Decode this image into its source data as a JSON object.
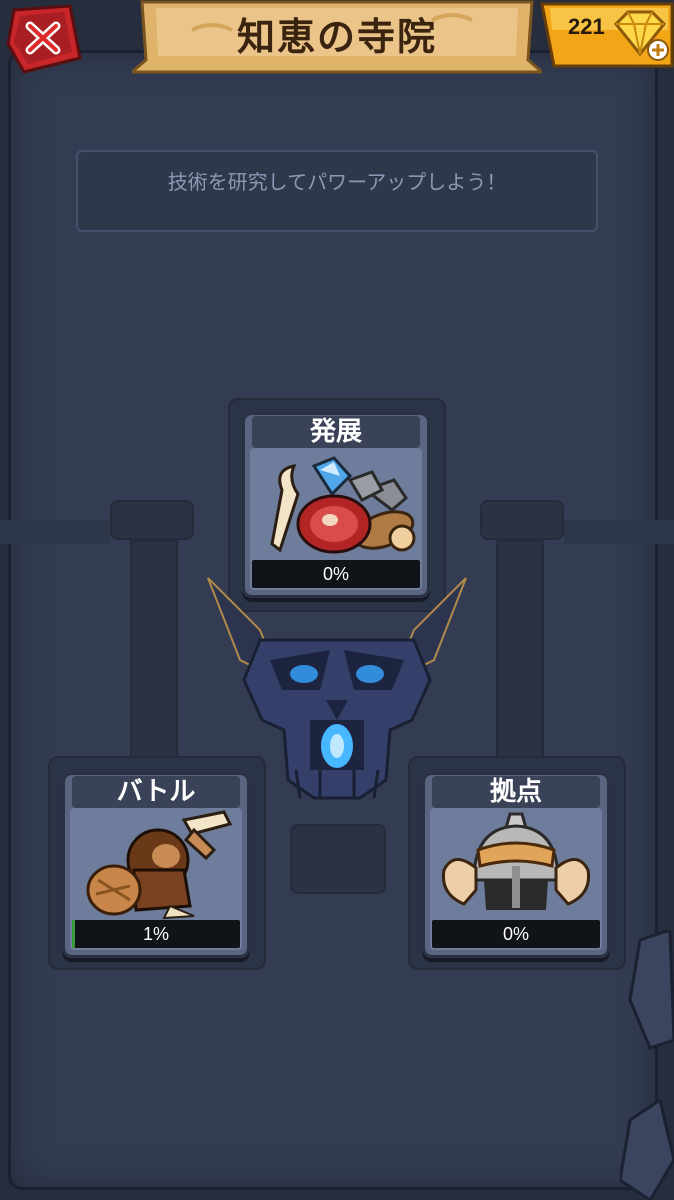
{
  "header": {
    "title": "知恵の寺院",
    "gem_count": "221"
  },
  "subtitle": "技術を研究してパワーアップしよう！",
  "cards": {
    "development": {
      "title": "発展",
      "percent": "0%",
      "progress": 0
    },
    "battle": {
      "title": "バトル",
      "percent": "1%",
      "progress": 0.01
    },
    "base": {
      "title": "拠点",
      "percent": "0%",
      "progress": 0
    }
  },
  "colors": {
    "banner": "#e0b36a",
    "gem_gold": "#f4b51c",
    "close_red": "#c8262a",
    "panel": "#333c52",
    "skull_glow": "#3aa6ff"
  },
  "icons": [
    "close-icon",
    "gem-icon",
    "plus-icon",
    "resources-icon",
    "warrior-icon",
    "helmet-icon",
    "skull-icon"
  ]
}
